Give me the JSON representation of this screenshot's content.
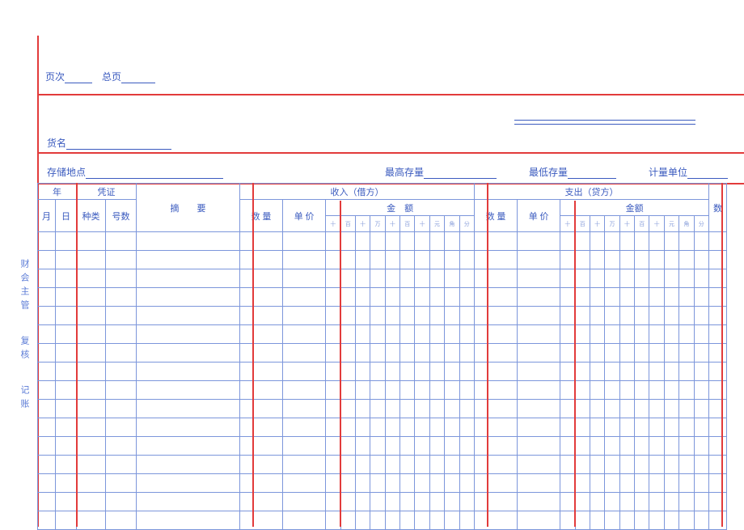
{
  "meta": {
    "page_no_label": "页次",
    "total_page_label": "总页"
  },
  "fields": {
    "name_label": "货名",
    "storage_label": "存储地点",
    "max_stock_label": "最高存量",
    "min_stock_label": "最低存量",
    "unit_label": "计量单位"
  },
  "side": {
    "a": "财会主管",
    "b": "复核",
    "c": "记账"
  },
  "headers": {
    "year": "年",
    "voucher": "凭证",
    "summary": "摘　　要",
    "income": "收入（借方）",
    "expense": "支出（贷方）",
    "month": "月",
    "day": "日",
    "kind": "种类",
    "number": "号数",
    "qty": "数 量",
    "unit_price": "单 价",
    "amount": "金　额",
    "amount2": "金额",
    "extra": "数"
  },
  "digit_units": [
    "十",
    "百",
    "十",
    "万",
    "十",
    "百",
    "十",
    "元",
    "角",
    "分"
  ],
  "body_rows": 16
}
